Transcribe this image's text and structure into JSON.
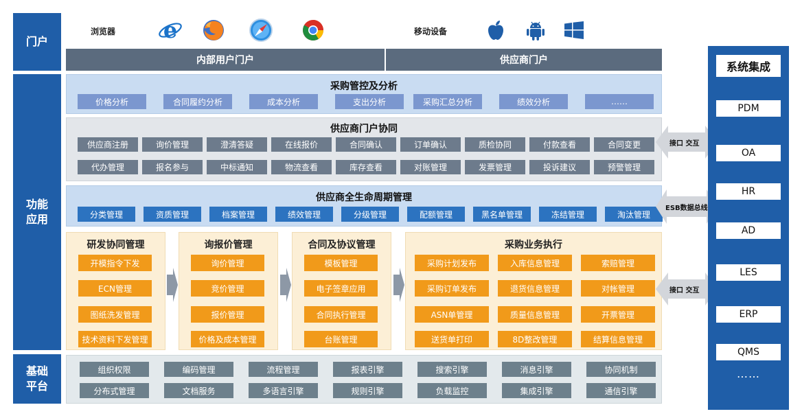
{
  "left_labels": {
    "portal": "门户",
    "function": "功能\n应用",
    "platform": "基础\n平台"
  },
  "portal": {
    "browser_label": "浏览器",
    "mobile_label": "移动设备",
    "browser_icons": [
      "ie-icon",
      "firefox-icon",
      "safari-icon",
      "chrome-icon"
    ],
    "mobile_icons": [
      "apple-icon",
      "android-icon",
      "windows-icon"
    ],
    "internal_portal": "内部用户门户",
    "supplier_portal": "供应商门户"
  },
  "procurement_control": {
    "title": "采购管控及分析",
    "items": [
      "价格分析",
      "合同履约分析",
      "成本分析",
      "支出分析",
      "采购汇总分析",
      "绩效分析",
      "……"
    ]
  },
  "supplier_portal_collab": {
    "title": "供应商门户协同",
    "row1": [
      "供应商注册",
      "询价管理",
      "澄清答疑",
      "在线报价",
      "合同确认",
      "订单确认",
      "质检协同",
      "付款查看",
      "合同变更"
    ],
    "row2": [
      "代办管理",
      "报名参与",
      "中标通知",
      "物流查看",
      "库存查看",
      "对账管理",
      "发票管理",
      "投诉建议",
      "预警管理"
    ]
  },
  "lifecycle": {
    "title": "供应商全生命周期管理",
    "items": [
      "分类管理",
      "资质管理",
      "档案管理",
      "绩效管理",
      "分级管理",
      "配额管理",
      "黑名单管理",
      "冻结管理",
      "淘汰管理"
    ]
  },
  "rd": {
    "title": "研发协同管理",
    "items": [
      "开模指令下发",
      "ECN管理",
      "图纸洗发管理",
      "技术资料下发管理"
    ]
  },
  "inquiry": {
    "title": "询报价管理",
    "items": [
      "询价管理",
      "竞价管理",
      "报价管理",
      "价格及成本管理"
    ]
  },
  "contract": {
    "title": "合同及协议管理",
    "items": [
      "模板管理",
      "电子签章应用",
      "合同执行管理",
      "台账管理"
    ]
  },
  "execution": {
    "title": "采购业务执行",
    "col1": [
      "采购计划发布",
      "采购订单发布",
      "ASN单管理",
      "送货单打印"
    ],
    "col2": [
      "入库信息管理",
      "退货信息管理",
      "质量信息管理",
      "8D整改管理"
    ],
    "col3": [
      "索赔管理",
      "对帐管理",
      "开票管理",
      "结算信息管理"
    ]
  },
  "platform": {
    "row1": [
      "组织权限",
      "编码管理",
      "流程管理",
      "报表引擎",
      "搜索引擎",
      "消息引擎",
      "协同机制"
    ],
    "row2": [
      "分布式管理",
      "文档服务",
      "多语言引擎",
      "规则引擎",
      "负载监控",
      "集成引擎",
      "通信引擎"
    ]
  },
  "connectors": {
    "top": "接口 交互",
    "middle": "ESB数据总线",
    "bottom": "接口 交互"
  },
  "system_integration": {
    "title": "系统集成",
    "items": [
      "PDM",
      "OA",
      "HR",
      "AD",
      "LES",
      "ERP",
      "QMS"
    ],
    "more": "……"
  },
  "colors": {
    "primary": "#1f5ea8",
    "orange": "#f19a1a",
    "light_blue_bg": "#c9dcf2",
    "gray_bg": "#e3e6ea",
    "cream_bg": "#fcefd6"
  }
}
